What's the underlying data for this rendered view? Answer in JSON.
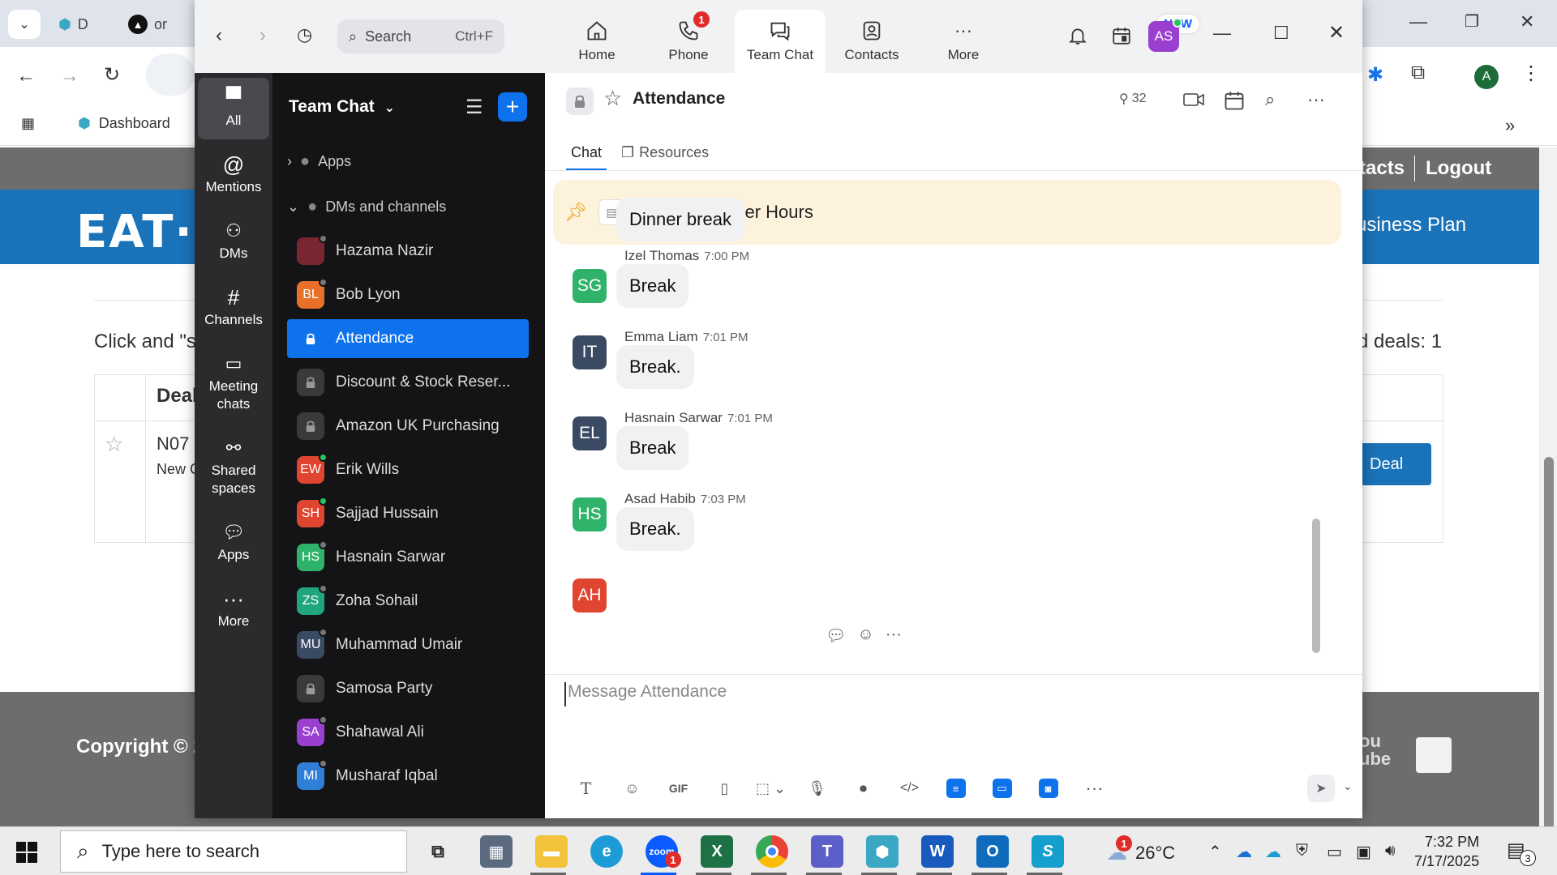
{
  "browser": {
    "tabs": [
      {
        "label": "D"
      },
      {
        "label": "or"
      }
    ],
    "bookmark_dashboard": "Dashboard",
    "profile_initial": "A"
  },
  "site": {
    "top_links": [
      "tacts",
      "Logout"
    ],
    "logo": "EAT·N",
    "business_plan": "usiness Plan",
    "click_text": "Click and \"st",
    "deals_text": "d deals: 1",
    "table_header": "Deal",
    "deal_id": "N07",
    "deal_sub": "New C",
    "deal_button": "Deal",
    "copyright": "Copyright © 20",
    "youtube": [
      "ou",
      "ube"
    ]
  },
  "zoom": {
    "search": {
      "label": "Search",
      "shortcut": "Ctrl+F"
    },
    "tabs": [
      {
        "label": "Home"
      },
      {
        "label": "Phone",
        "badge": "1"
      },
      {
        "label": "Team Chat"
      },
      {
        "label": "Contacts"
      },
      {
        "label": "More",
        "badge": "NEW"
      }
    ],
    "user_initials": "AS",
    "rail": [
      {
        "label": "All"
      },
      {
        "label": "Mentions"
      },
      {
        "label": "DMs"
      },
      {
        "label": "Channels"
      },
      {
        "label": "Meeting chats"
      },
      {
        "label": "Shared spaces"
      },
      {
        "label": "Apps"
      },
      {
        "label": "More"
      }
    ],
    "list": {
      "title": "Team Chat",
      "sections": {
        "apps": "Apps",
        "dms": "DMs and channels"
      },
      "items": [
        {
          "label": "Hazama Nazir",
          "initials": "",
          "color": "#7a2630"
        },
        {
          "label": "Bob Lyon",
          "initials": "BL",
          "color": "#e8702a"
        },
        {
          "label": "Attendance",
          "initials": "",
          "color": ""
        },
        {
          "label": "Discount & Stock Reser...",
          "initials": "",
          "color": ""
        },
        {
          "label": "Amazon UK Purchasing",
          "initials": "",
          "color": ""
        },
        {
          "label": "Erik Wills",
          "initials": "EW",
          "color": "#e0452f"
        },
        {
          "label": "Sajjad Hussain",
          "initials": "SH",
          "color": "#e0452f"
        },
        {
          "label": "Hasnain Sarwar",
          "initials": "HS",
          "color": "#2fb36a"
        },
        {
          "label": "Zoha Sohail",
          "initials": "ZS",
          "color": "#20a57e"
        },
        {
          "label": "Muhammad Umair",
          "initials": "MU",
          "color": "#3b4a63"
        },
        {
          "label": "Samosa Party",
          "initials": "",
          "color": ""
        },
        {
          "label": "Shahawal Ali",
          "initials": "SA",
          "color": "#9b3fd0"
        },
        {
          "label": "Musharaf Iqbal",
          "initials": "MI",
          "color": "#2f7fd6"
        }
      ]
    },
    "channel": {
      "title": "Attendance",
      "members": "32",
      "tabs": {
        "chat": "Chat",
        "resources": "Resources"
      },
      "pinned": "Updated Dinner Hours",
      "messages": [
        {
          "initials": "SG",
          "color": "#2fb36a",
          "name": "",
          "time": "",
          "text": "Dinner break"
        },
        {
          "initials": "IT",
          "color": "#3b4a63",
          "name": "Izel Thomas",
          "time": "7:00 PM",
          "text": "Break"
        },
        {
          "initials": "EL",
          "color": "#3b4a63",
          "name": "Emma Liam",
          "time": "7:01 PM",
          "text": "Break."
        },
        {
          "initials": "HS",
          "color": "#2fb36a",
          "name": "Hasnain Sarwar",
          "time": "7:01 PM",
          "text": "Break"
        },
        {
          "initials": "AH",
          "color": "#e0452f",
          "name": "Asad Habib",
          "time": "7:03 PM",
          "text": "Break."
        }
      ],
      "compose_placeholder": "Message Attendance"
    }
  },
  "taskbar": {
    "search_placeholder": "Type here to search",
    "temperature": "26°C",
    "time": "7:32 PM",
    "date": "7/17/2025",
    "notifications": "3",
    "zoom_badge": "1",
    "weather_badge": "1"
  }
}
